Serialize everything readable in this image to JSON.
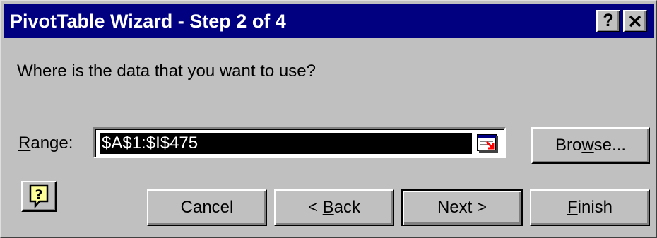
{
  "window": {
    "title": "PivotTable Wizard - Step 2 of 4",
    "help_button": "?",
    "close_button": "✕"
  },
  "prompt": "Where is the data that you want to use?",
  "range": {
    "label_mnemonic": "R",
    "label_rest": "ange:",
    "value": "$A$1:$I$475",
    "collapse_icon": "collapse-dialog-icon"
  },
  "browse_button": {
    "before": "Bro",
    "mnemonic": "w",
    "after": "se..."
  },
  "buttons": {
    "cancel": "Cancel",
    "back_prefix": "< ",
    "back_mnemonic": "B",
    "back_rest": "ack",
    "next": "Next >",
    "finish_mnemonic": "F",
    "finish_rest": "inish"
  },
  "office_help_icon": "office-assistant-help-icon",
  "colors": {
    "titlebar": "#000080",
    "face": "#c0c0c0",
    "selection": "#000000"
  }
}
